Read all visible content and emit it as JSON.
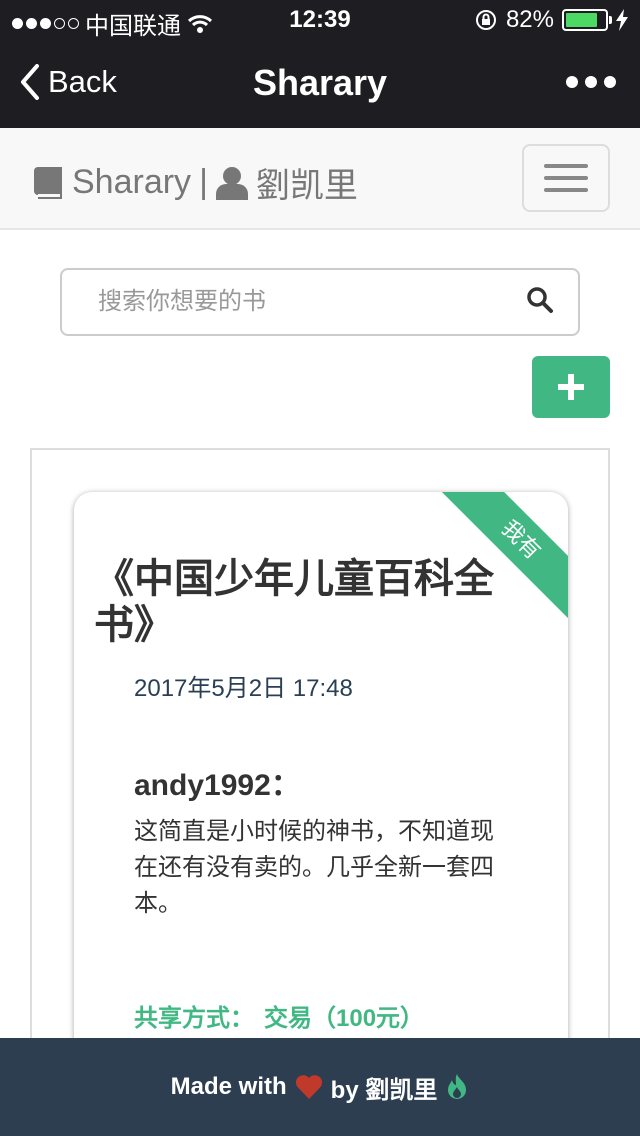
{
  "status_bar": {
    "carrier": "中国联通",
    "time": "12:39",
    "battery_percent": "82%",
    "battery_level": 0.82
  },
  "nav": {
    "back_label": "Back",
    "title": "Sharary"
  },
  "header": {
    "brand_name": "Sharary",
    "separator": "|",
    "user_name": "劉凯里"
  },
  "search": {
    "placeholder": "搜索你想要的书"
  },
  "feed": {
    "posts": [
      {
        "badge": "我有",
        "book_title": "《中国少年儿童百科全书》",
        "date": "2017年5月2日 17:48",
        "poster": "andy1992：",
        "body": "这简直是小时候的神书，不知道现在还有没有卖的。几乎全新一套四本。",
        "share_label": "共享方式：",
        "share_value": "交易（100元）"
      }
    ]
  },
  "footer": {
    "made_with": "Made with",
    "by": "by 劉凯里"
  },
  "colors": {
    "accent": "#41b883",
    "navbar": "#1e1e22",
    "footer": "#2c3e50",
    "heart": "#c0392b"
  }
}
